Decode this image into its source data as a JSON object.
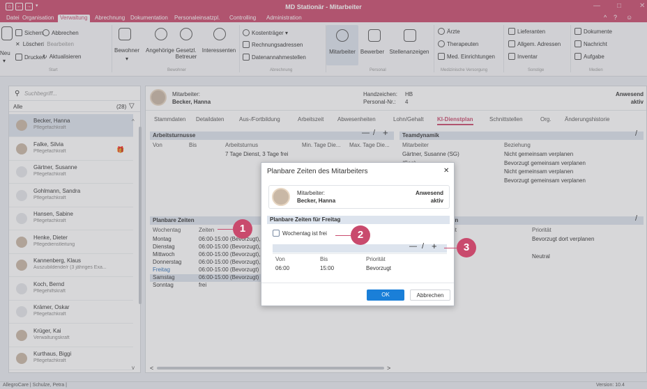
{
  "window": {
    "title": "MD Stationär - Mitarbeiter"
  },
  "menu": [
    "Datei",
    "Organisation",
    "Verwaltung",
    "Abrechnung",
    "Dokumentation",
    "Personaleinsatzpl.",
    "Controlling",
    "Administration"
  ],
  "ribbon": {
    "neu": "Neu",
    "sichern": "Sichern",
    "abbrechen": "Abbrechen",
    "loeschen": "Löschen",
    "bearbeiten": "Bearbeiten",
    "drucken": "Drucken",
    "aktualisieren": "Aktualisieren",
    "start_group": "Start",
    "bewohner": "Bewohner",
    "angehoerige": "Angehörige",
    "gesetzl": "Gesetzl.",
    "betreuer": "Betreuer",
    "interessenten": "Interessenten",
    "bewohner_group": "Bewohner",
    "kostentraeger": "Kostenträger",
    "rechnungsadressen": "Rechnungsadressen",
    "datenannahmestellen": "Datenannahmestellen",
    "abrechnung_group": "Abrechnung",
    "mitarbeiter": "Mitarbeiter",
    "bewerber": "Bewerber",
    "stellenanzeigen": "Stellenanzeigen",
    "personal_group": "Personal",
    "aerzte": "Ärzte",
    "therapeuten": "Therapeuten",
    "med_einrichtungen": "Med. Einrichtungen",
    "med_group": "Medizinische Versorgung",
    "lieferanten": "Lieferanten",
    "allgem_adressen": "Allgem. Adressen",
    "inventar": "Inventar",
    "sonstige_group": "Sonstige",
    "dokumente": "Dokumente",
    "nachricht": "Nachricht",
    "aufgabe": "Aufgabe",
    "medien_group": "Medien"
  },
  "left": {
    "search_placeholder": "Suchbegriff...",
    "filter": "Alle",
    "count": "(28)",
    "employees": [
      {
        "name": "Becker, Hanna",
        "role": "Pflegefachkraft"
      },
      {
        "name": "Falke, Silvia",
        "role": "Pflegefachkraft"
      },
      {
        "name": "Gärtner, Susanne",
        "role": "Pflegefachkraft"
      },
      {
        "name": "Gohlmann, Sandra",
        "role": "Pflegefachkraft"
      },
      {
        "name": "Hansen, Sabine",
        "role": "Pflegefachkraft"
      },
      {
        "name": "Henke, Dieter",
        "role": "Pflegedienstleitung"
      },
      {
        "name": "Kannenberg, Klaus",
        "role": "Auszubildende/r (3 jähriges Exa..."
      },
      {
        "name": "Koch, Bernd",
        "role": "Pflegehilfskraft"
      },
      {
        "name": "Krämer, Oskar",
        "role": "Pflegefachkraft"
      },
      {
        "name": "Krüger, Kai",
        "role": "Verwaltungskraft"
      },
      {
        "name": "Kurthaus, Biggi",
        "role": "Pflegefachkraft"
      }
    ]
  },
  "header": {
    "mitarbeiter_label": "Mitarbeiter:",
    "mitarbeiter_name": "Becker, Hanna",
    "handzeichen_label": "Handzeichen:",
    "handzeichen": "HB",
    "personalnr_label": "Personal-Nr.:",
    "personalnr": "4",
    "status": "Anwesend",
    "status2": "aktiv"
  },
  "tabs": [
    "Stammdaten",
    "Detaildaten",
    "Aus-/Fortbildung",
    "Arbeitszeit",
    "Abwesenheiten",
    "Lohn/Gehalt",
    "KI-Dienstplan",
    "Schnittstellen",
    "Org.",
    "Änderungshistorie"
  ],
  "arbeitsturnusse": {
    "title": "Arbeitsturnusse",
    "columns": [
      "Von",
      "Bis",
      "Arbeitsturnus",
      "Min. Tage Die...",
      "Max. Tage Die..."
    ],
    "row": "7 Tage Dienst, 3 Tage frei"
  },
  "teamdynamik": {
    "title": "Teamdynamik",
    "columns": [
      "Mitarbeiter",
      "Beziehung"
    ],
    "rows": [
      {
        "m": "Gärtner, Susanne (SG)",
        "b": "Nicht gemeinsam verplanen"
      },
      {
        "m": "(Sag)",
        "b": "Bevorzugt gemeinsam verplanen"
      },
      {
        "m": "",
        "b": "Nicht gemeinsam verplanen"
      },
      {
        "m": "",
        "b": "Bevorzugt gemeinsam verplanen"
      }
    ]
  },
  "planbare": {
    "title": "Planbare Zeiten",
    "columns": [
      "Wochentag",
      "Zeiten"
    ],
    "rows": [
      {
        "d": "Montag",
        "z": "06:00-15:00 (Bevorzugt),"
      },
      {
        "d": "Dienstag",
        "z": "06:00-15:00 (Bevorzugt),"
      },
      {
        "d": "Mittwoch",
        "z": "06:00-15:00 (Bevorzugt),"
      },
      {
        "d": "Donnerstag",
        "z": "06:00-15:00 (Bevorzugt),"
      },
      {
        "d": "Freitag",
        "z": "06:00-15:00 (Bevorzugt)"
      },
      {
        "d": "Samstag",
        "z": "06:00-15:00 (Bevorzugt)"
      },
      {
        "d": "Sonntag",
        "z": "frei"
      }
    ]
  },
  "bereiche": {
    "title": "iten",
    "col1": "it",
    "col2": "Priorität",
    "rows": [
      "Bevorzugt dort verplanen",
      "",
      "Neutral"
    ]
  },
  "dialog": {
    "title": "Planbare Zeiten des Mitarbeiters",
    "mitarbeiter_label": "Mitarbeiter:",
    "mitarbeiter_name": "Becker, Hanna",
    "status": "Anwesend",
    "status2": "aktiv",
    "section": "Planbare Zeiten für Freitag",
    "checkbox": "Wochentag ist frei",
    "columns": [
      "Von",
      "Bis",
      "Priorität"
    ],
    "row": {
      "von": "06:00",
      "bis": "15:00",
      "prio": "Bevorzugt"
    },
    "ok": "OK",
    "cancel": "Abbrechen"
  },
  "callouts": [
    "1",
    "2",
    "3"
  ],
  "status": {
    "left": "AllegroCare | Schulze, Petra |",
    "right": "Version: 10.4"
  },
  "colors": {
    "accent": "#c94a6d",
    "highlight": "#dde4ee",
    "ok_button": "#1a7fd8"
  }
}
